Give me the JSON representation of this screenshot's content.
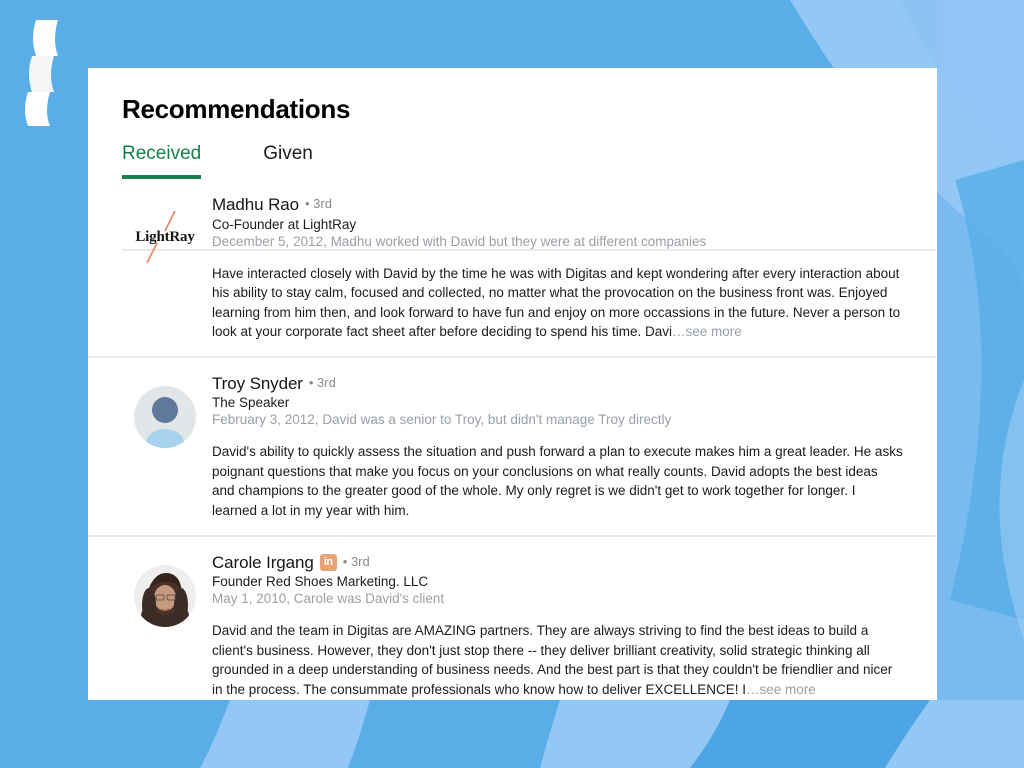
{
  "theme": {
    "background_blue": "#5aaee8",
    "background_blue_light": "#93c7f5",
    "card_background": "#ffffff",
    "accent_green": "#16824a",
    "divider": "#e8eaed",
    "muted_text": "#9aa0a6",
    "badge_orange": "#e8a477"
  },
  "header": {
    "title": "Recommendations"
  },
  "tabs": [
    {
      "label": "Received",
      "active": true
    },
    {
      "label": "Given",
      "active": false
    }
  ],
  "recommendations": [
    {
      "name": "Madhu Rao",
      "degree": "• 3rd",
      "title": "Co-Founder at LightRay",
      "meta": "December 5, 2012, Madhu worked with David but they were at different companies",
      "body": "Have interacted closely with David by the time he was with Digitas and kept wondering after every interaction about his ability to stay calm, focused and collected, no matter what the provocation on the business front was. Enjoyed learning from him then, and look forward to have fun and enjoy on more occassions in the future. Never a person to look at your corporate fact sheet after before deciding to spend his time. Davi",
      "see_more": "…see more",
      "has_see_more": true,
      "has_linkedin_badge": false,
      "avatar_type": "lightray-logo",
      "avatar_label": "LightRay"
    },
    {
      "name": "Troy Snyder",
      "degree": "• 3rd",
      "title": "The Speaker",
      "meta": "February 3, 2012, David was a senior to Troy, but didn't manage Troy directly",
      "body": "David's ability to quickly assess the situation and push forward a plan to execute makes him a great leader. He asks poignant questions that make you focus on your conclusions on what really counts. David adopts the best ideas and champions to the greater good of the whole. My only regret is we didn't get to work together for longer. I learned a lot in my year with him.",
      "see_more": "",
      "has_see_more": false,
      "has_linkedin_badge": false,
      "avatar_type": "default-person",
      "avatar_label": ""
    },
    {
      "name": "Carole Irgang",
      "degree": "• 3rd",
      "title": "Founder Red Shoes Marketing. LLC",
      "meta": "May 1, 2010, Carole was David's client",
      "body": "David and the team in Digitas are AMAZING partners. They are always striving to find the best ideas to build a client's business. However, they don't just stop there -- they deliver brilliant creativity, solid strategic thinking all grounded in a deep understanding of business needs. And the best part is that they couldn't be friendlier and nicer in the process. The consummate professionals who know how to deliver EXCELLENCE! I",
      "see_more": "…see more",
      "has_see_more": true,
      "has_linkedin_badge": true,
      "linkedin_badge_text": "in",
      "avatar_type": "photo-portrait",
      "avatar_label": ""
    }
  ]
}
